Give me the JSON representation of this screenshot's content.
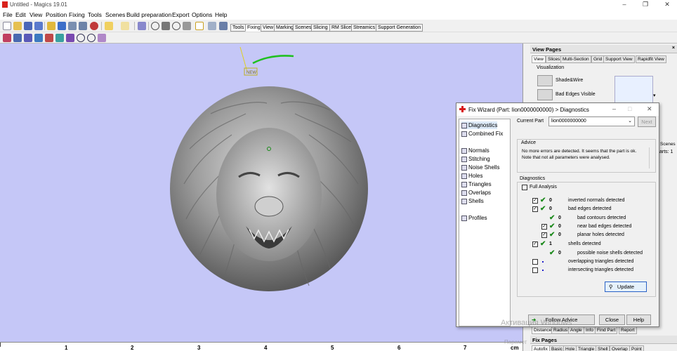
{
  "window": {
    "title": "Untitled - Magics 19.01"
  },
  "menu": [
    "File",
    "Edit",
    "View",
    "Position",
    "Fixing",
    "Tools",
    "Scenes",
    "Build preparation",
    "Export",
    "Options",
    "Help"
  ],
  "toolbar_tabs": [
    "Tools",
    "Fixing",
    "View",
    "Marking",
    "Scenes",
    "Slicing",
    "RM Slicer",
    "Streamics",
    "Support Generation"
  ],
  "toolbar_active_tab": "Fixing",
  "ruler": {
    "unit": "cm",
    "labels": [
      "1",
      "2",
      "3",
      "4",
      "5",
      "6",
      "7"
    ]
  },
  "viewport": {
    "part_label": "NEW"
  },
  "view_pages": {
    "title": "View Pages",
    "tabs": [
      "View",
      "Slices",
      "Multi-Section",
      "Grid",
      "Support View",
      "Rapidfit View"
    ],
    "active_tab": "View",
    "section": "Visualization",
    "items": [
      "Shade&Wire",
      "Bad Edges Visible"
    ]
  },
  "right_partial": {
    "scenes_tab": "Scenes",
    "parts_text": "arts: 1"
  },
  "measure_tabs": [
    "Distance",
    "Radius",
    "Angle",
    "Info",
    "Find Part",
    "Report"
  ],
  "fix_pages": {
    "title": "Fix Pages",
    "tabs": [
      "Autofix",
      "Basic",
      "Hole",
      "Triangle",
      "Shell",
      "Overlap",
      "Point"
    ]
  },
  "fix_wizard": {
    "title": "Fix Wizard (Part: lion0000000000) > Diagnostics",
    "nav": [
      "Diagnostics",
      "Combined Fix",
      "Normals",
      "Stitching",
      "Noise Shells",
      "Holes",
      "Triangles",
      "Overlaps",
      "Shells",
      "Profiles"
    ],
    "current_part_label": "Current Part",
    "current_part_value": "lion0000000000",
    "next_button": "Next",
    "advice_title": "Advice",
    "advice_text": "No more errors are detected. It seems that the part is ok. Note that not all parameters were analysed.",
    "diagnostics_title": "Diagnostics",
    "full_analysis": "Full Analysis",
    "rows": [
      {
        "label": "inverted normals detected",
        "count": "0"
      },
      {
        "label": "bad edges detected",
        "count": "0"
      },
      {
        "label": "bad contours detected",
        "count": "0"
      },
      {
        "label": "near bad edges detected",
        "count": "0"
      },
      {
        "label": "planar holes detected",
        "count": "0"
      },
      {
        "label": "shells detected",
        "count": "1"
      },
      {
        "label": "possible noise shells detected",
        "count": "0"
      },
      {
        "label": "overlapping triangles detected",
        "count": ""
      },
      {
        "label": "intersecting triangles detected",
        "count": ""
      }
    ],
    "update_button": "Update",
    "follow_advice_button": "Follow Advice",
    "close_button": "Close",
    "help_button": "Help"
  },
  "watermark": {
    "line1": "Активация Windows",
    "line2": "Парамет"
  }
}
